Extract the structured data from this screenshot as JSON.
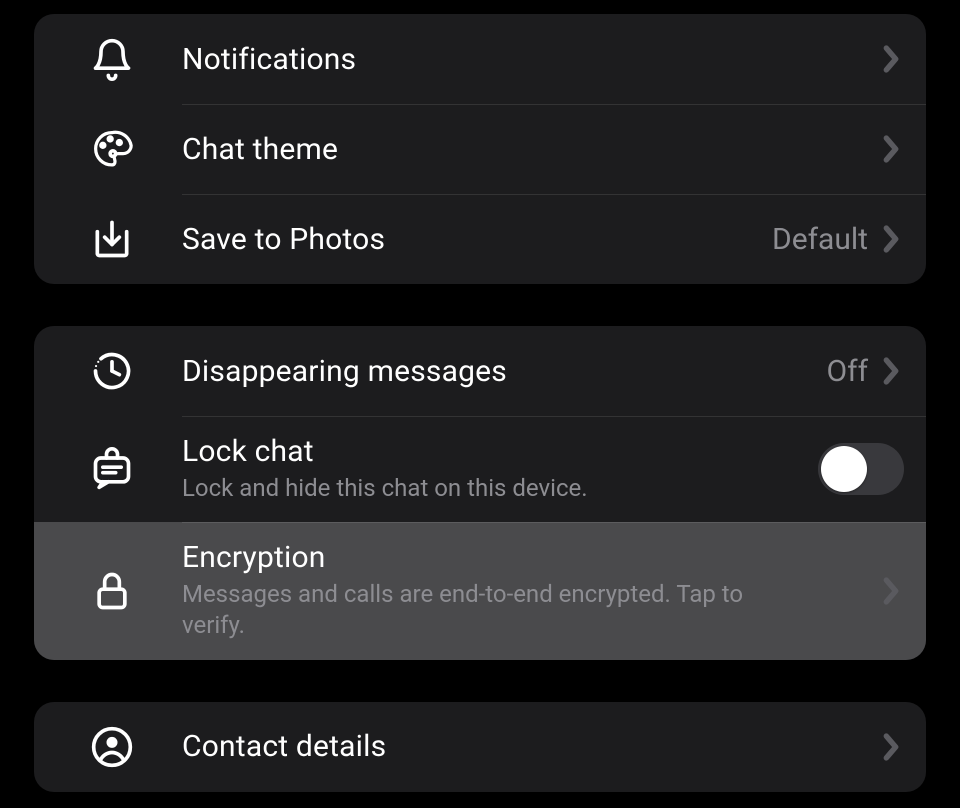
{
  "groups": [
    {
      "rows": [
        {
          "icon": "bell",
          "title": "Notifications",
          "trailing": {
            "type": "chevron"
          }
        },
        {
          "icon": "palette",
          "title": "Chat theme",
          "trailing": {
            "type": "chevron"
          }
        },
        {
          "icon": "download",
          "title": "Save to Photos",
          "trailing": {
            "type": "value-chevron",
            "value": "Default"
          }
        }
      ]
    },
    {
      "rows": [
        {
          "icon": "timer",
          "title": "Disappearing messages",
          "trailing": {
            "type": "value-chevron",
            "value": "Off"
          }
        },
        {
          "icon": "lockchat",
          "title": "Lock chat",
          "subtitle": "Lock and hide this chat on this device.",
          "trailing": {
            "type": "toggle",
            "on": false
          }
        },
        {
          "icon": "lock",
          "title": "Encryption",
          "subtitle": "Messages and calls are end-to-end encrypted. Tap to verify.",
          "trailing": {
            "type": "chevron"
          },
          "highlight": true
        }
      ]
    },
    {
      "rows": [
        {
          "icon": "person",
          "title": "Contact details",
          "trailing": {
            "type": "chevron"
          }
        }
      ]
    }
  ]
}
